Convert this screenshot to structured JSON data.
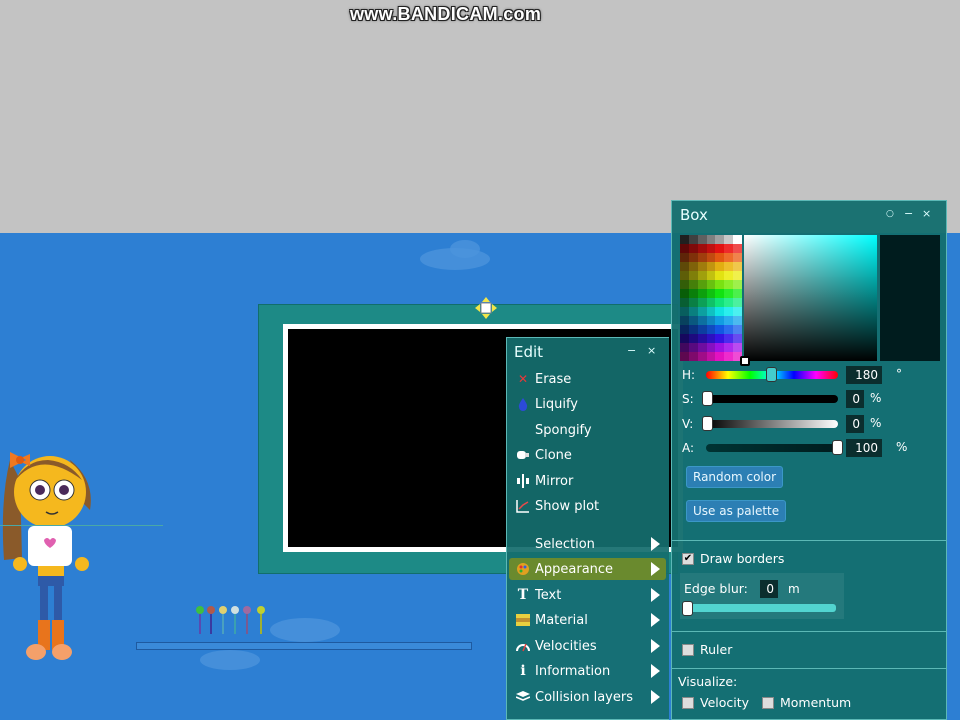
{
  "watermark": "www.BANDICAM.com",
  "edit_menu": {
    "title": "Edit",
    "minimize": "−",
    "close": "×",
    "items": [
      {
        "label": "Erase",
        "icon": "erase-icon"
      },
      {
        "label": "Liquify",
        "icon": "liquify-icon"
      },
      {
        "label": "Spongify",
        "icon": ""
      },
      {
        "label": "Clone",
        "icon": "clone-icon"
      },
      {
        "label": "Mirror",
        "icon": "mirror-icon"
      },
      {
        "label": "Show plot",
        "icon": "plot-icon"
      }
    ],
    "submenus": [
      {
        "label": "Selection",
        "icon": ""
      },
      {
        "label": "Appearance",
        "icon": "palette-icon",
        "active": true
      },
      {
        "label": "Text",
        "icon": "text-icon"
      },
      {
        "label": "Material",
        "icon": "material-icon"
      },
      {
        "label": "Velocities",
        "icon": "velocity-icon"
      },
      {
        "label": "Information",
        "icon": "info-icon"
      },
      {
        "label": "Collision layers",
        "icon": "layers-icon"
      }
    ]
  },
  "box_panel": {
    "title": "Box",
    "restore": "○",
    "minimize": "−",
    "close": "×",
    "color": {
      "h_label": "H:",
      "h_value": "180",
      "h_unit": "°",
      "s_label": "S:",
      "s_value": "0",
      "s_unit": "%",
      "v_label": "V:",
      "v_value": "0",
      "v_unit": "%",
      "a_label": "A:",
      "a_value": "100",
      "a_unit": "%",
      "current_color": "#001c1e"
    },
    "random_color_label": "Random color",
    "use_as_palette_label": "Use as palette",
    "draw_borders_label": "Draw borders",
    "draw_borders_checked": true,
    "edge_blur_label": "Edge blur:",
    "edge_blur_value": "0",
    "edge_blur_unit": "m",
    "ruler_label": "Ruler",
    "ruler_checked": false,
    "visualize_label": "Visualize:",
    "velocity_label": "Velocity",
    "momentum_label": "Momentum"
  },
  "colors": {
    "panel_bg": "#146e6e",
    "sky": "#2d7fd3",
    "board": "#1d8a86",
    "active_item": "#6a8a2e"
  }
}
